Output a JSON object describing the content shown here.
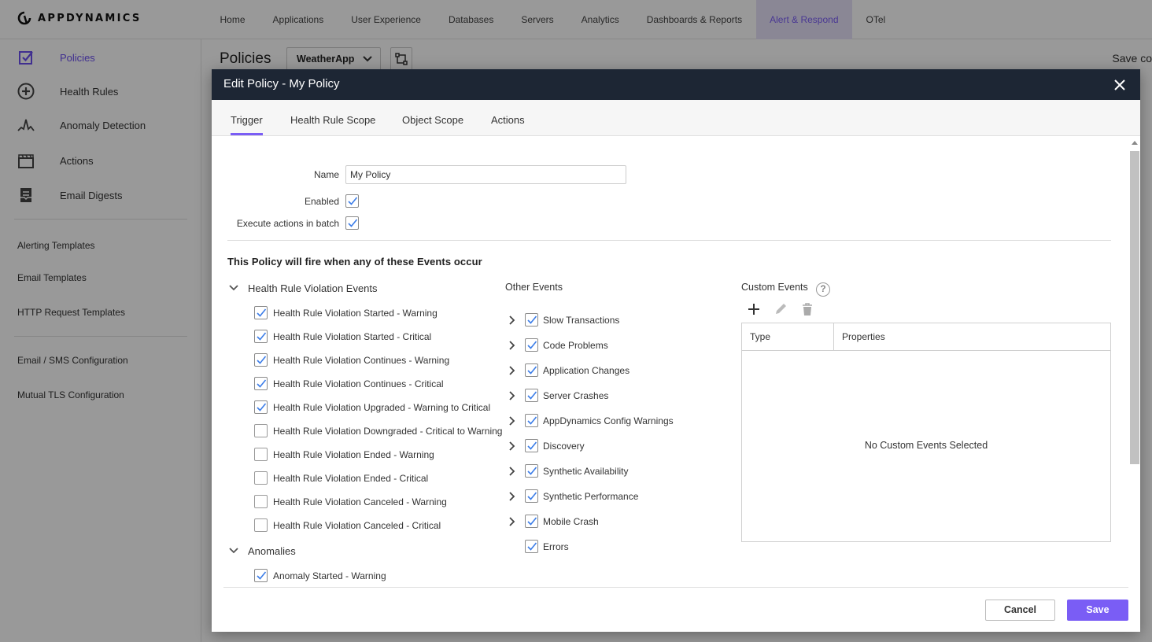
{
  "app": {
    "brand": "APPDYNAMICS",
    "accent_color": "#7a5df5",
    "header_color": "#1d2634"
  },
  "nav": {
    "items": [
      {
        "label": "Home"
      },
      {
        "label": "Applications"
      },
      {
        "label": "User Experience"
      },
      {
        "label": "Databases"
      },
      {
        "label": "Servers"
      },
      {
        "label": "Analytics"
      },
      {
        "label": "Dashboards & Reports"
      },
      {
        "label": "Alert & Respond",
        "active": true
      },
      {
        "label": "OTel"
      }
    ]
  },
  "sidebar": {
    "main_items": [
      {
        "label": "Policies",
        "icon": "checkbox-icon",
        "active": true
      },
      {
        "label": "Health Rules",
        "icon": "plus-circle-icon"
      },
      {
        "label": "Anomaly Detection",
        "icon": "anomaly-icon"
      },
      {
        "label": "Actions",
        "icon": "clapperboard-icon"
      },
      {
        "label": "Email Digests",
        "icon": "inbox-icon"
      }
    ],
    "templates": [
      {
        "label": "Alerting Templates"
      },
      {
        "label": "Email Templates"
      },
      {
        "label": "HTTP Request Templates"
      }
    ],
    "config": [
      {
        "label": "Email / SMS Configuration"
      },
      {
        "label": "Mutual TLS Configuration"
      }
    ]
  },
  "page": {
    "title": "Policies",
    "app_selector": "WeatherApp",
    "save_corner": "Save co"
  },
  "modal": {
    "title": "Edit Policy - My Policy",
    "tabs": [
      {
        "label": "Trigger",
        "active": true
      },
      {
        "label": "Health Rule Scope"
      },
      {
        "label": "Object Scope"
      },
      {
        "label": "Actions"
      }
    ],
    "form": {
      "name_label": "Name",
      "name_value": "My Policy",
      "enabled_label": "Enabled",
      "enabled": true,
      "batch_label": "Execute actions in batch",
      "batch": true
    },
    "section_title": "This Policy will fire when any of these Events occur",
    "health_rule_group": {
      "label": "Health Rule Violation Events",
      "events": [
        {
          "label": "Health Rule Violation Started - Warning",
          "checked": true
        },
        {
          "label": "Health Rule Violation Started - Critical",
          "checked": true
        },
        {
          "label": "Health Rule Violation Continues - Warning",
          "checked": true
        },
        {
          "label": "Health Rule Violation Continues - Critical",
          "checked": true
        },
        {
          "label": "Health Rule Violation Upgraded - Warning to Critical",
          "checked": true
        },
        {
          "label": "Health Rule Violation Downgraded - Critical to Warning",
          "checked": false
        },
        {
          "label": "Health Rule Violation Ended - Warning",
          "checked": false
        },
        {
          "label": "Health Rule Violation Ended - Critical",
          "checked": false
        },
        {
          "label": "Health Rule Violation Canceled - Warning",
          "checked": false
        },
        {
          "label": "Health Rule Violation Canceled - Critical",
          "checked": false
        }
      ]
    },
    "anomalies_group": {
      "label": "Anomalies",
      "events": [
        {
          "label": "Anomaly Started - Warning",
          "checked": true
        }
      ]
    },
    "other_events": {
      "label": "Other Events",
      "events": [
        {
          "label": "Slow Transactions",
          "checked": true,
          "expandable": true
        },
        {
          "label": "Code Problems",
          "checked": true,
          "expandable": true
        },
        {
          "label": "Application Changes",
          "checked": true,
          "expandable": true
        },
        {
          "label": "Server Crashes",
          "checked": true,
          "expandable": true
        },
        {
          "label": "AppDynamics Config Warnings",
          "checked": true,
          "expandable": true
        },
        {
          "label": "Discovery",
          "checked": true,
          "expandable": true
        },
        {
          "label": "Synthetic Availability",
          "checked": true,
          "expandable": true
        },
        {
          "label": "Synthetic Performance",
          "checked": true,
          "expandable": true
        },
        {
          "label": "Mobile Crash",
          "checked": true,
          "expandable": true
        },
        {
          "label": "Errors",
          "checked": true,
          "expandable": false
        }
      ]
    },
    "custom_events": {
      "label": "Custom Events",
      "help": "?",
      "columns": [
        "Type",
        "Properties"
      ],
      "empty_text": "No Custom Events Selected"
    },
    "footer": {
      "cancel": "Cancel",
      "save": "Save"
    }
  }
}
